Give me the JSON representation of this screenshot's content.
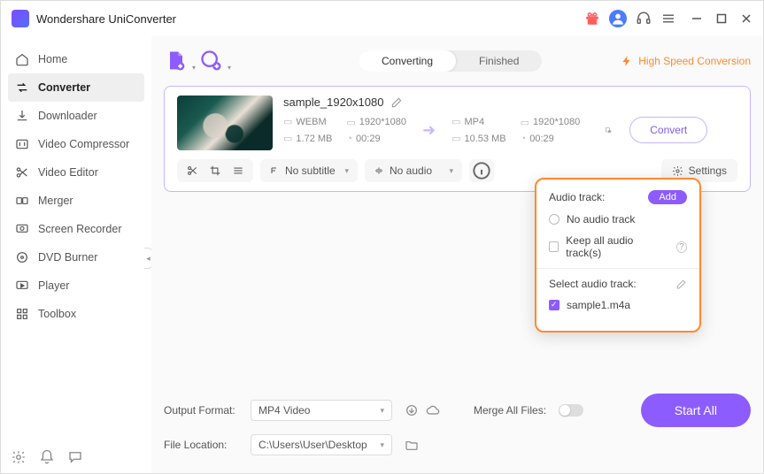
{
  "app": {
    "title": "Wondershare UniConverter"
  },
  "sidebar": {
    "items": [
      {
        "label": "Home"
      },
      {
        "label": "Converter"
      },
      {
        "label": "Downloader"
      },
      {
        "label": "Video Compressor"
      },
      {
        "label": "Video Editor"
      },
      {
        "label": "Merger"
      },
      {
        "label": "Screen Recorder"
      },
      {
        "label": "DVD Burner"
      },
      {
        "label": "Player"
      },
      {
        "label": "Toolbox"
      }
    ]
  },
  "tabs": {
    "converting": "Converting",
    "finished": "Finished"
  },
  "hsc": "High Speed Conversion",
  "file": {
    "name": "sample_1920x1080",
    "src": {
      "format": "WEBM",
      "res": "1920*1080",
      "size": "1.72 MB",
      "dur": "00:29"
    },
    "dst": {
      "format": "MP4",
      "res": "1920*1080",
      "size": "10.53 MB",
      "dur": "00:29"
    }
  },
  "row2": {
    "subtitle": "No subtitle",
    "audio": "No audio",
    "settings": "Settings"
  },
  "convert": "Convert",
  "popover": {
    "title": "Audio track:",
    "add": "Add",
    "noTrack": "No audio track",
    "keepAll": "Keep all audio track(s)",
    "selectTitle": "Select audio track:",
    "track1": "sample1.m4a"
  },
  "bottom": {
    "outFmtLabel": "Output Format:",
    "outFmt": "MP4 Video",
    "locLabel": "File Location:",
    "loc": "C:\\Users\\User\\Desktop",
    "merge": "Merge All Files:",
    "startAll": "Start All"
  }
}
